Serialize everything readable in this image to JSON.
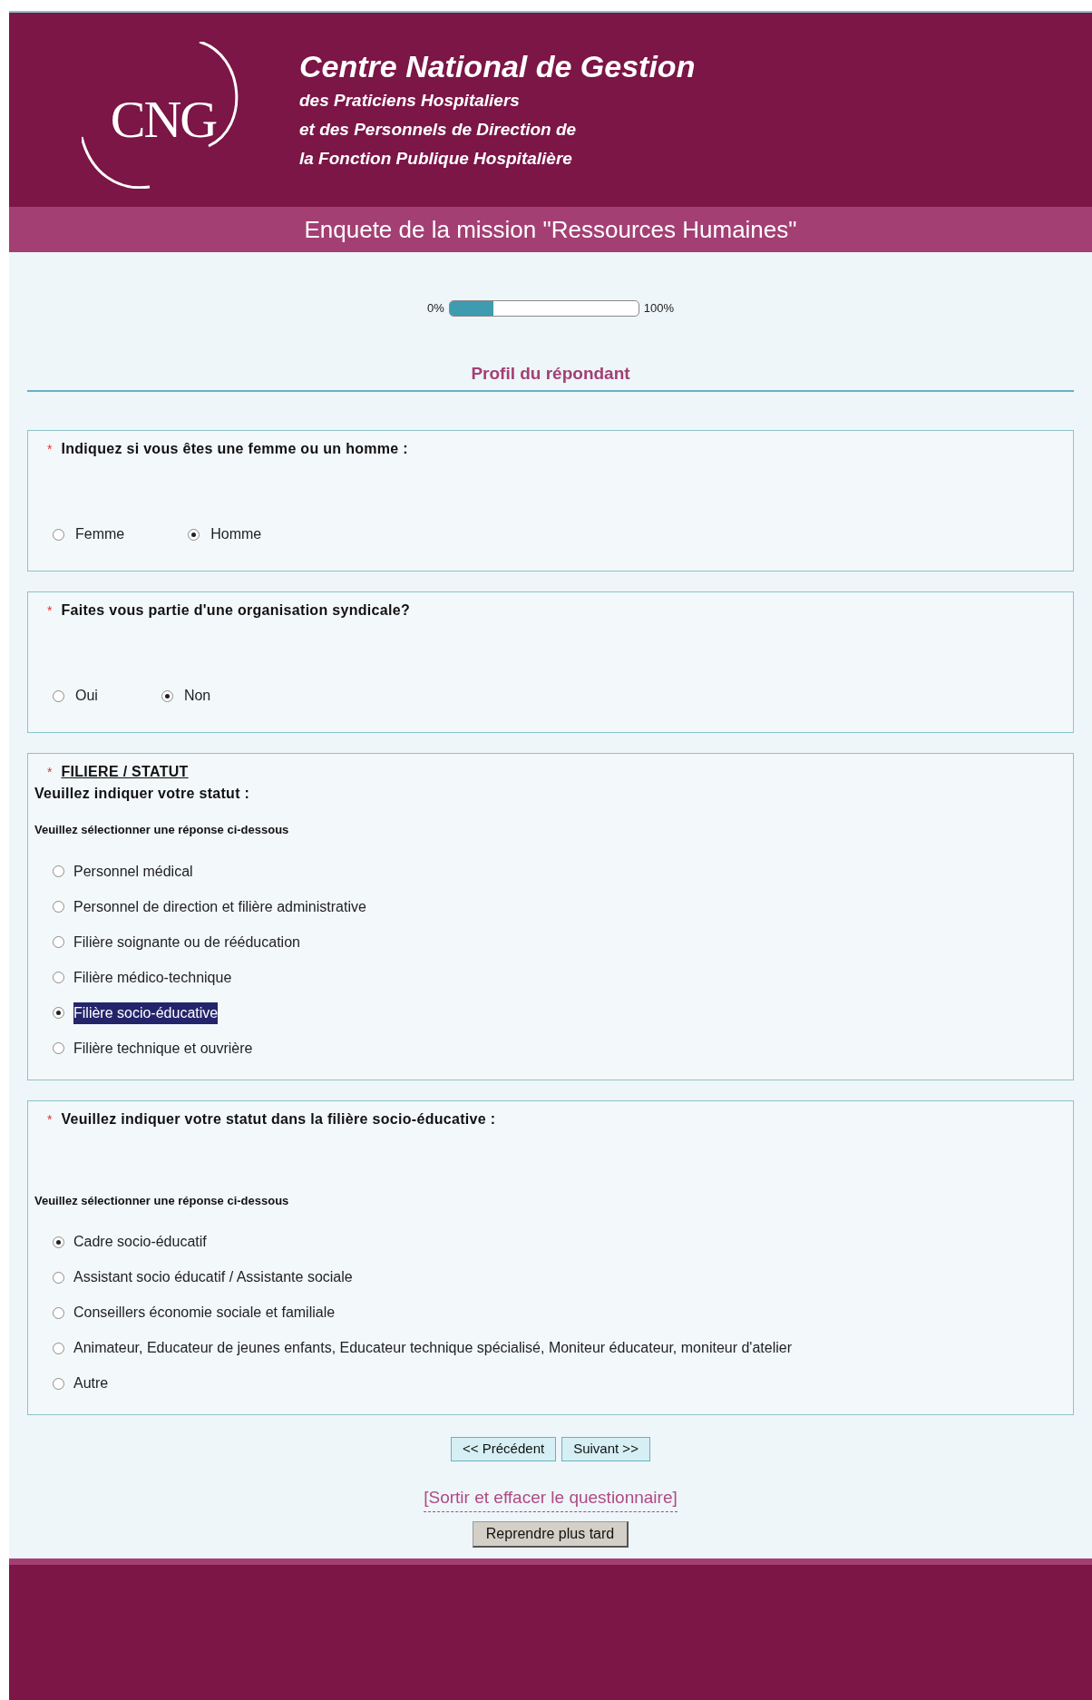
{
  "header": {
    "logo_text": "CNG",
    "title": "Centre National de Gestion",
    "subtitle_lines": [
      "des Praticiens Hospitaliers",
      "et des Personnels de Direction de",
      "la Fonction Publique Hospitalière"
    ]
  },
  "survey_title": "Enquete de la mission \"Ressources Humaines\"",
  "progress": {
    "start_label": "0%",
    "end_label": "100%",
    "level": 0.23
  },
  "section_title": "Profil du répondant",
  "questions": [
    {
      "required_mark": "*",
      "heading": "Indiquez si vous êtes une femme ou un homme :",
      "kind": "horizontal",
      "options": [
        {
          "label": "Femme",
          "selected": false
        },
        {
          "label": "Homme",
          "selected": true
        }
      ]
    },
    {
      "required_mark": "*",
      "heading": "Faites vous partie d'une organisation syndicale?",
      "kind": "horizontal",
      "options": [
        {
          "label": "Oui",
          "selected": false
        },
        {
          "label": "Non",
          "selected": true
        }
      ]
    },
    {
      "required_mark": "*",
      "heading": "FILIERE / STATUT",
      "heading_underlined": true,
      "subheading": "Veuillez indiquer votre statut :",
      "instruction": "Veuillez sélectionner une réponse ci-dessous",
      "kind": "vertical",
      "options": [
        {
          "label": "Personnel médical",
          "selected": false,
          "highlighted": false
        },
        {
          "label": "Personnel de direction et filière administrative",
          "selected": false,
          "highlighted": false
        },
        {
          "label": "Filière soignante ou de rééducation",
          "selected": false,
          "highlighted": false
        },
        {
          "label": "Filière médico-technique",
          "selected": false,
          "highlighted": false
        },
        {
          "label": "Filière socio-éducative",
          "selected": true,
          "highlighted": true
        },
        {
          "label": "Filière technique et ouvrière",
          "selected": false,
          "highlighted": false
        }
      ]
    },
    {
      "required_mark": "*",
      "heading": "Veuillez indiquer votre statut dans la filière socio-éducative :",
      "instruction": "Veuillez sélectionner une réponse ci-dessous",
      "kind": "vertical",
      "options": [
        {
          "label": "Cadre socio-éducatif",
          "selected": true
        },
        {
          "label": "Assistant socio éducatif / Assistante sociale",
          "selected": false
        },
        {
          "label": "Conseillers économie sociale et familiale",
          "selected": false
        },
        {
          "label": "Animateur, Educateur de jeunes enfants, Educateur technique spécialisé, Moniteur éducateur, moniteur d'atelier",
          "selected": false
        },
        {
          "label": "Autre",
          "selected": false
        }
      ]
    }
  ],
  "nav_buttons": [
    "<< Précédent",
    "Suivant >>"
  ],
  "exit_link": "[Sortir et effacer le questionnaire]",
  "resume_button": "Reprendre plus tard"
}
